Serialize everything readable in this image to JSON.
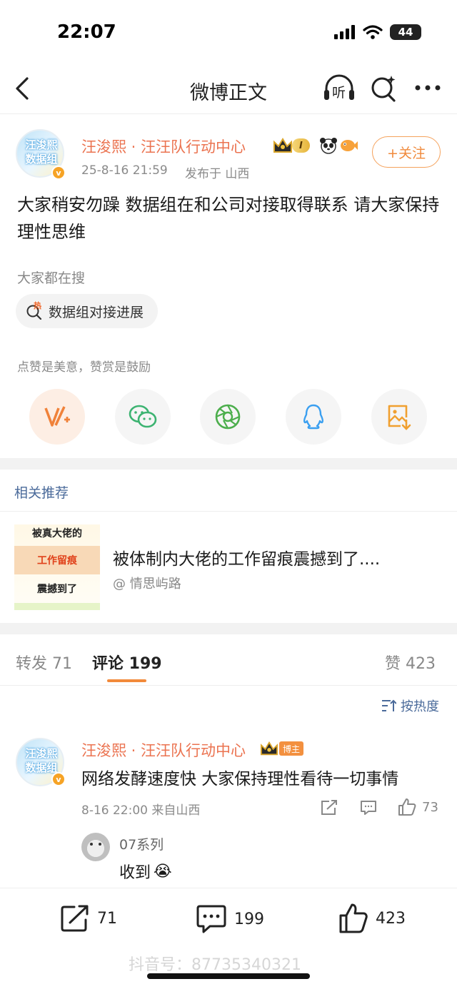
{
  "status_bar": {
    "time": "22:07",
    "battery": "44"
  },
  "nav": {
    "title": "微博正文",
    "listen_label": "听"
  },
  "post": {
    "avatar_text_line1": "汪浚熙",
    "avatar_text_line2": "数据组",
    "username": "汪浚熙 · 汪汪队行动中心",
    "vip_level": "I",
    "timestamp": "25-8-16 21:59",
    "location": "发布于 山西",
    "follow_label": "+关注",
    "text": "大家稍安勿躁 数据组在和公司对接取得联系 请大家保持理性思维",
    "search_label": "大家都在搜",
    "hot_tag": "数据组对接进展",
    "hot_icon_label": "热",
    "praise_label": "点赞是美意，赞赏是鼓励"
  },
  "related": {
    "section_label": "相关推荐",
    "thumb_line1": "被真大佬的",
    "thumb_line2": "工作留痕",
    "thumb_line3": "震撼到了",
    "title": "被体制内大佬的工作留痕震撼到了....",
    "author": "@ 情思屿路"
  },
  "tabs": {
    "repost": "转发 71",
    "comment": "评论 199",
    "like": "赞 423"
  },
  "sort_label": "按热度",
  "comment": {
    "username": "汪浚熙 · 汪汪队行动中心",
    "host_badge": "博主",
    "text": "网络发酵速度快 大家保持理性看待一切事情",
    "meta": "8-16 22:00 来自山西",
    "likes": "73",
    "reply": {
      "name": "07系列",
      "text": "收到",
      "emoji": "😭"
    }
  },
  "bottom_bar": {
    "repost": "71",
    "comment": "199",
    "like": "423"
  },
  "watermark": "抖音号：87735340321",
  "colors": {
    "accent": "#eb7350",
    "follow": "#f08a3c",
    "link": "#4a6a9a"
  }
}
